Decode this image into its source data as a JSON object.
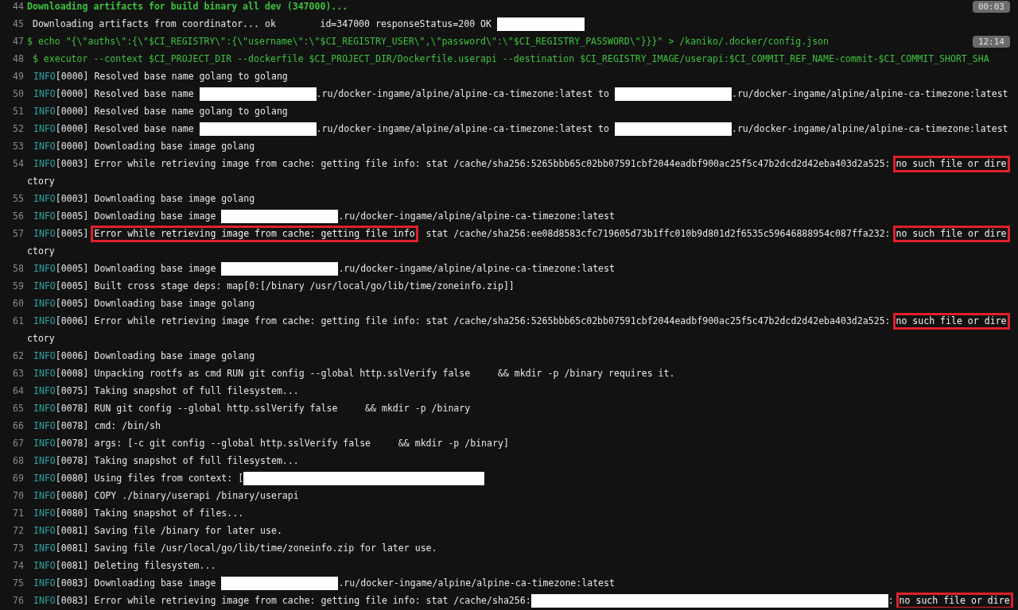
{
  "lines": [
    {
      "number": "44",
      "kind": "section",
      "segments": [
        {
          "kind": "text",
          "text": "Downloading artifacts for build binary all dev (347000)..."
        }
      ],
      "badge": "00:03"
    },
    {
      "number": "45",
      "kind": "output",
      "segments": [
        {
          "kind": "text",
          "text": " Downloading artifacts from coordinator... ok        id=347000 responseStatus=200 OK "
        },
        {
          "kind": "redacted-short"
        }
      ]
    },
    {
      "number": "47",
      "kind": "command",
      "segments": [
        {
          "kind": "text",
          "text": "$ echo \"{\\\"auths\\\":{\\\"$CI_REGISTRY\\\":{\\\"username\\\":\\\"$CI_REGISTRY_USER\\\",\\\"password\\\":\\\"$CI_REGISTRY_PASSWORD\\\"}}}\" > /kaniko/.docker/config.json"
        }
      ],
      "badge": "12:14"
    },
    {
      "number": "48",
      "kind": "command",
      "segments": [
        {
          "kind": "text",
          "text": " $ executor --context $CI_PROJECT_DIR --dockerfile $CI_PROJECT_DIR/Dockerfile.userapi --destination $CI_REGISTRY_IMAGE/userapi:$CI_COMMIT_REF_NAME-commit-$CI_COMMIT_SHORT_SHA"
        }
      ]
    },
    {
      "number": "49",
      "kind": "info",
      "tag": "INFO",
      "segments": [
        {
          "kind": "text",
          "text": "[0000] Resolved base name golang to golang"
        }
      ]
    },
    {
      "number": "50",
      "kind": "info",
      "tag": "INFO",
      "segments": [
        {
          "kind": "text",
          "text": "[0000] Resolved base name "
        },
        {
          "kind": "redacted-host"
        },
        {
          "kind": "text",
          "text": ".ru/docker-ingame/alpine/alpine-ca-timezone:latest to "
        },
        {
          "kind": "redacted-host"
        },
        {
          "kind": "text",
          "text": ".ru/docker-ingame/alpine/alpine-ca-timezone:latest"
        }
      ]
    },
    {
      "number": "51",
      "kind": "info",
      "tag": "INFO",
      "segments": [
        {
          "kind": "text",
          "text": "[0000] Resolved base name golang to golang"
        }
      ]
    },
    {
      "number": "52",
      "kind": "info",
      "tag": "INFO",
      "segments": [
        {
          "kind": "text",
          "text": "[0000] Resolved base name "
        },
        {
          "kind": "redacted-host"
        },
        {
          "kind": "text",
          "text": ".ru/docker-ingame/alpine/alpine-ca-timezone:latest to "
        },
        {
          "kind": "redacted-host"
        },
        {
          "kind": "text",
          "text": ".ru/docker-ingame/alpine/alpine-ca-timezone:latest"
        }
      ]
    },
    {
      "number": "53",
      "kind": "info",
      "tag": "INFO",
      "segments": [
        {
          "kind": "text",
          "text": "[0000] Downloading base image golang"
        }
      ]
    },
    {
      "number": "54",
      "kind": "info",
      "tag": "INFO",
      "segments": [
        {
          "kind": "text",
          "text": "[0003] Error while retrieving image from cache: getting file info: stat /cache/sha256:5265bbb65c02bb07591cbf2044eadbf900ac25f5c47b2dcd2d42eba403d2a525: "
        },
        {
          "kind": "boxed",
          "text": "no such file or dire"
        }
      ],
      "continuation": "ctory"
    },
    {
      "number": "55",
      "kind": "info",
      "tag": "INFO",
      "segments": [
        {
          "kind": "text",
          "text": "[0003] Downloading base image golang"
        }
      ]
    },
    {
      "number": "56",
      "kind": "info",
      "tag": "INFO",
      "segments": [
        {
          "kind": "text",
          "text": "[0005] Downloading base image "
        },
        {
          "kind": "redacted-host"
        },
        {
          "kind": "text",
          "text": ".ru/docker-ingame/alpine/alpine-ca-timezone:latest"
        }
      ]
    },
    {
      "number": "57",
      "kind": "info",
      "tag": "INFO",
      "segments": [
        {
          "kind": "text",
          "text": "[0005] "
        },
        {
          "kind": "boxed",
          "text": "Error while retrieving image from cache: getting file info"
        },
        {
          "kind": "text",
          "text": "  stat /cache/sha256:ee08d8583cfc719605d73b1ffc010b9d801d2f6535c59646888954c087ffa232: "
        },
        {
          "kind": "boxed",
          "text": "no such file or dire"
        }
      ],
      "continuation": "ctory"
    },
    {
      "number": "58",
      "kind": "info",
      "tag": "INFO",
      "segments": [
        {
          "kind": "text",
          "text": "[0005] Downloading base image "
        },
        {
          "kind": "redacted-host"
        },
        {
          "kind": "text",
          "text": ".ru/docker-ingame/alpine/alpine-ca-timezone:latest"
        }
      ]
    },
    {
      "number": "59",
      "kind": "info",
      "tag": "INFO",
      "segments": [
        {
          "kind": "text",
          "text": "[0005] Built cross stage deps: map[0:[/binary /usr/local/go/lib/time/zoneinfo.zip]]"
        }
      ]
    },
    {
      "number": "60",
      "kind": "info",
      "tag": "INFO",
      "segments": [
        {
          "kind": "text",
          "text": "[0005] Downloading base image golang"
        }
      ]
    },
    {
      "number": "61",
      "kind": "info",
      "tag": "INFO",
      "segments": [
        {
          "kind": "text",
          "text": "[0006] Error while retrieving image from cache: getting file info: stat /cache/sha256:5265bbb65c02bb07591cbf2044eadbf900ac25f5c47b2dcd2d42eba403d2a525: "
        },
        {
          "kind": "boxed",
          "text": "no such file or dire"
        }
      ],
      "continuation": "ctory"
    },
    {
      "number": "62",
      "kind": "info",
      "tag": "INFO",
      "segments": [
        {
          "kind": "text",
          "text": "[0006] Downloading base image golang"
        }
      ]
    },
    {
      "number": "63",
      "kind": "info",
      "tag": "INFO",
      "segments": [
        {
          "kind": "text",
          "text": "[0008] Unpacking rootfs as cmd RUN git config --global http.sslVerify false     && mkdir -p /binary requires it."
        }
      ]
    },
    {
      "number": "64",
      "kind": "info",
      "tag": "INFO",
      "segments": [
        {
          "kind": "text",
          "text": "[0075] Taking snapshot of full filesystem..."
        }
      ]
    },
    {
      "number": "65",
      "kind": "info",
      "tag": "INFO",
      "segments": [
        {
          "kind": "text",
          "text": "[0078] RUN git config --global http.sslVerify false     && mkdir -p /binary"
        }
      ]
    },
    {
      "number": "66",
      "kind": "info",
      "tag": "INFO",
      "segments": [
        {
          "kind": "text",
          "text": "[0078] cmd: /bin/sh"
        }
      ]
    },
    {
      "number": "67",
      "kind": "info",
      "tag": "INFO",
      "segments": [
        {
          "kind": "text",
          "text": "[0078] args: [-c git config --global http.sslVerify false     && mkdir -p /binary]"
        }
      ]
    },
    {
      "number": "68",
      "kind": "info",
      "tag": "INFO",
      "segments": [
        {
          "kind": "text",
          "text": "[0078] Taking snapshot of full filesystem..."
        }
      ]
    },
    {
      "number": "69",
      "kind": "info",
      "tag": "INFO",
      "segments": [
        {
          "kind": "text",
          "text": "[0080] Using files from context: ["
        },
        {
          "kind": "redacted-path"
        }
      ]
    },
    {
      "number": "70",
      "kind": "info",
      "tag": "INFO",
      "segments": [
        {
          "kind": "text",
          "text": "[0080] COPY ./binary/userapi /binary/userapi"
        }
      ]
    },
    {
      "number": "71",
      "kind": "info",
      "tag": "INFO",
      "segments": [
        {
          "kind": "text",
          "text": "[0080] Taking snapshot of files..."
        }
      ]
    },
    {
      "number": "72",
      "kind": "info",
      "tag": "INFO",
      "segments": [
        {
          "kind": "text",
          "text": "[0081] Saving file /binary for later use."
        }
      ]
    },
    {
      "number": "73",
      "kind": "info",
      "tag": "INFO",
      "segments": [
        {
          "kind": "text",
          "text": "[0081] Saving file /usr/local/go/lib/time/zoneinfo.zip for later use."
        }
      ]
    },
    {
      "number": "74",
      "kind": "info",
      "tag": "INFO",
      "segments": [
        {
          "kind": "text",
          "text": "[0081] Deleting filesystem..."
        }
      ]
    },
    {
      "number": "75",
      "kind": "info",
      "tag": "INFO",
      "segments": [
        {
          "kind": "text",
          "text": "[0083] Downloading base image "
        },
        {
          "kind": "redacted-host"
        },
        {
          "kind": "text",
          "text": ".ru/docker-ingame/alpine/alpine-ca-timezone:latest"
        }
      ]
    },
    {
      "number": "76",
      "kind": "info",
      "tag": "INFO",
      "segments": [
        {
          "kind": "text",
          "text": "[0083] Error while retrieving image from cache: getting file info: stat /cache/sha256:"
        },
        {
          "kind": "redacted-hash"
        },
        {
          "kind": "text",
          "text": ": "
        },
        {
          "kind": "boxed",
          "text": "no such file or dire"
        }
      ]
    }
  ]
}
